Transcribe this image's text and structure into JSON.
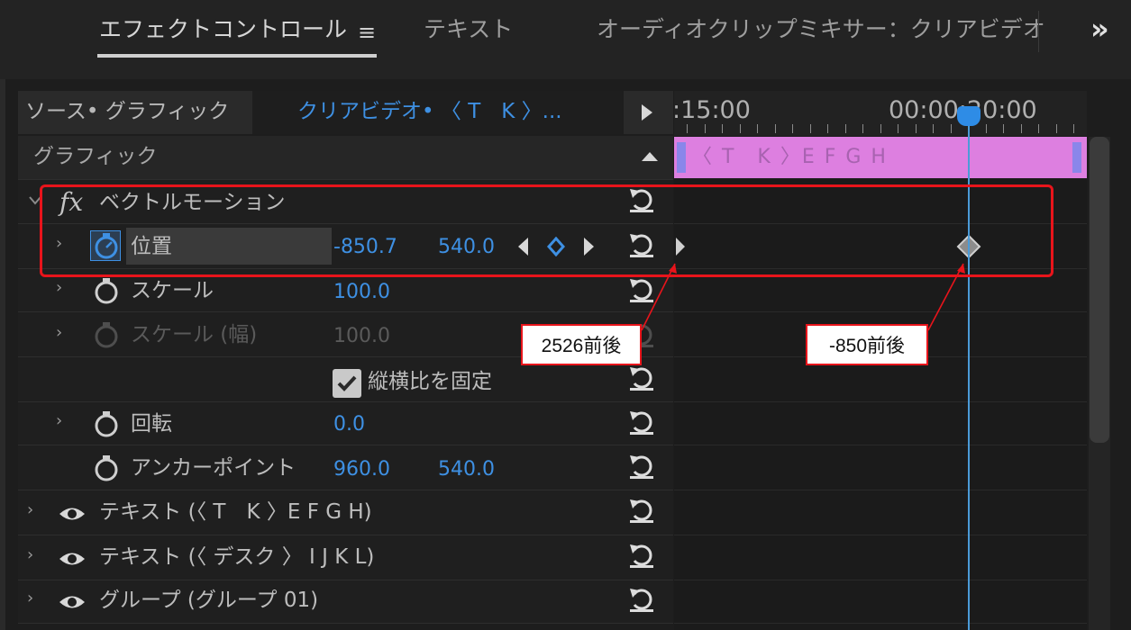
{
  "tabs": {
    "effect_controls": "エフェクトコントロール",
    "menu_icon": "≡",
    "text": "テキスト",
    "audio_mixer": "オーディオクリップミキサー：クリアビデオ",
    "overflow": "»"
  },
  "source_header": {
    "source_label": "ソース• グラフィック",
    "dropdown_icon": "chevron-down-icon",
    "clip_label": "クリアビデオ• 〈 T　K 〉...",
    "play_icon": "play-icon"
  },
  "timeline": {
    "time_left": ":15:00",
    "time_right": "00:00:20:00",
    "clip_name": "〈 T　K 〉E F G H",
    "clip_color": "#dd7fe0",
    "playhead_color": "#2e8ce6"
  },
  "rows": {
    "graphic_header": "グラフィック",
    "vector_motion": {
      "fx": "fx",
      "label": "ベクトルモーション"
    },
    "position": {
      "label": "位置",
      "x": "-850.7",
      "y": "540.0"
    },
    "scale": {
      "label": "スケール",
      "value": "100.0"
    },
    "scale_width": {
      "label": "スケール (幅)",
      "value": "100.0"
    },
    "uniform_scale": {
      "label": "縦横比を固定",
      "checked": true
    },
    "rotation": {
      "label": "回転",
      "value": "0.0"
    },
    "anchor": {
      "label": "アンカーポイント",
      "x": "960.0",
      "y": "540.0"
    },
    "layers": [
      {
        "label": "テキスト (〈 T　K 〉E F G H)"
      },
      {
        "label": "テキスト (〈 デスク 〉 I J K L)"
      },
      {
        "label": "グループ (グループ 01)"
      }
    ]
  },
  "annotations": {
    "callout_left": "2526前後",
    "callout_right": "-850前後",
    "accent_color": "#e8141b"
  }
}
